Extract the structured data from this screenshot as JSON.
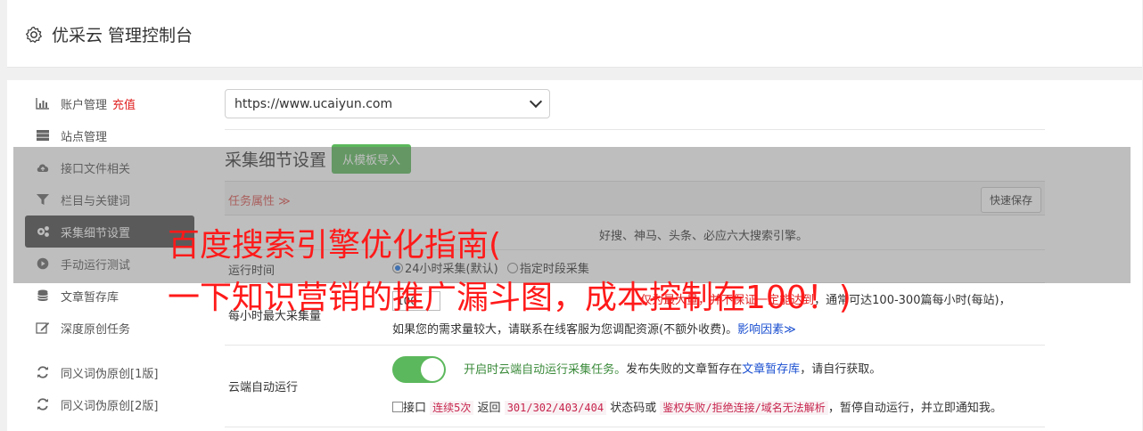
{
  "header": {
    "title": "优采云 管理控制台",
    "icon": "gear-icon"
  },
  "sidebar": {
    "items": [
      {
        "label": "账户管理",
        "tag": "充值",
        "icon": "bar-chart-icon"
      },
      {
        "label": "站点管理",
        "icon": "server-icon"
      },
      {
        "label": "接口文件相关",
        "icon": "cloud-upload-icon"
      },
      {
        "label": "栏目与关键词",
        "icon": "filter-icon"
      },
      {
        "label": "采集细节设置",
        "icon": "cogs-icon",
        "active": true
      },
      {
        "label": "手动运行测试",
        "icon": "play-circle-icon"
      },
      {
        "label": "文章暂存库",
        "icon": "database-icon"
      },
      {
        "label": "深度原创任务",
        "icon": "edit-icon"
      },
      {
        "label": "同义词伪原创[1版]",
        "icon": "refresh-icon"
      },
      {
        "label": "同义词伪原创[2版]",
        "icon": "refresh-icon"
      }
    ]
  },
  "site_select": {
    "value": "https://www.ucaiyun.com"
  },
  "section": {
    "title": "采集细节设置",
    "import_button": "从模板导入"
  },
  "table": {
    "task_attr": "任务属性 ≫",
    "quick_save": "快速保存",
    "rows": {
      "engines": {
        "partial": "好搜、神马、头条、必应六大搜索引擎。"
      },
      "run_time": {
        "label": "运行时间",
        "opt1": "24小时采集(默认)",
        "opt2": "指定时段采集"
      },
      "max_per_hour": {
        "label": "每小时最大采集量",
        "value": "100",
        "line1_red": "仅为最大量，并不保证一定能达到",
        "line1_tail": "，通常可达100-300篇每小时(每站)，",
        "line2": "如果您的需求量较大，请联系在线客服为您调配资源(不额外收费)。",
        "line2_link": "影响因素≫"
      },
      "cloud_auto": {
        "label": "云端自动运行",
        "green": "开启时云端自动运行采集任务。",
        "text1": "发布失败的文章暂存在",
        "link": "文章暂存库",
        "text1_tail": "，请自行获取。",
        "c1": "接口",
        "c2": "连续5次",
        "c3": "返回",
        "c4": "301/302/403/404",
        "c5": "状态码或",
        "c6": "鉴权失败/拒绝连接/域名无法解析",
        "c7": "，暂停自动运行，并立即通知我。"
      }
    }
  },
  "overlay": {
    "line1": "百度搜索引擎优化指南(",
    "line2": "一下知识营销的推广漏斗图，成本控制在100！)"
  },
  "colors": {
    "accent_green": "#5cb85c",
    "danger_red": "#e02020",
    "sidebar_active": "#4a4a4a"
  }
}
